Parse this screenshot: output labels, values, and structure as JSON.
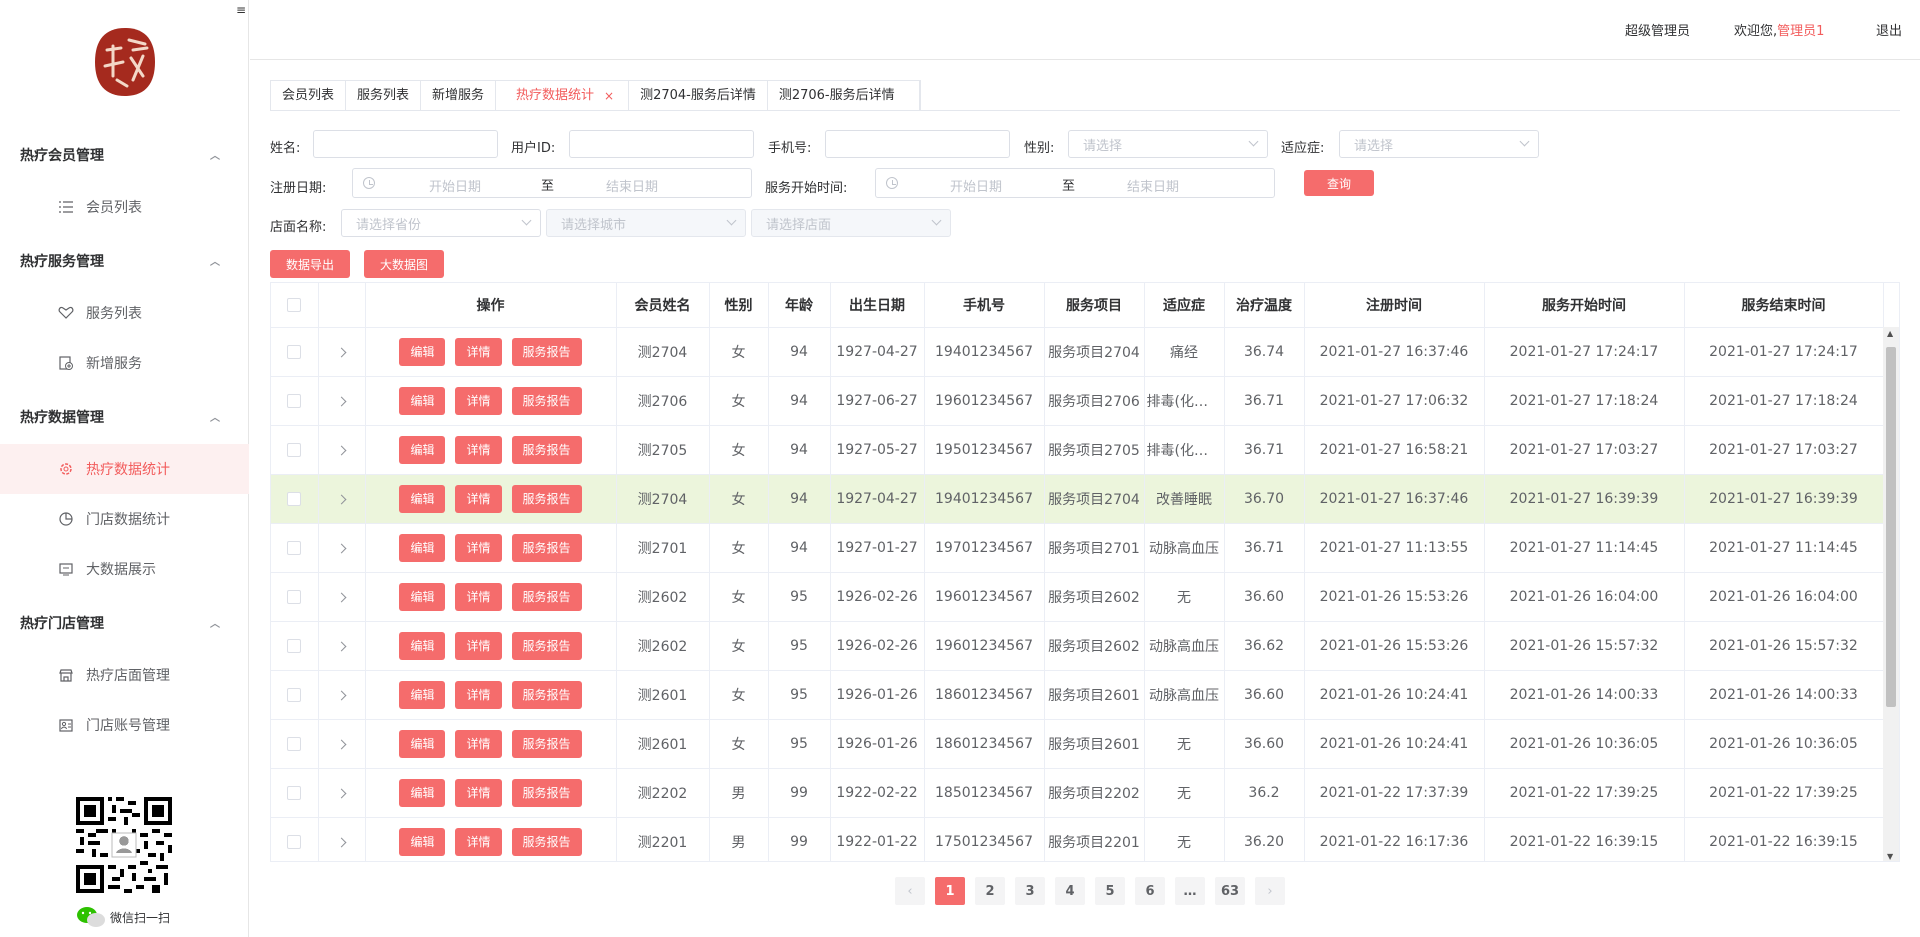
{
  "sidebar": {
    "collapse_icon": "≡",
    "groups": [
      {
        "title": "热疗会员管理",
        "items": [
          {
            "label": "会员列表",
            "icon": "list-icon"
          }
        ]
      },
      {
        "title": "热疗服务管理",
        "items": [
          {
            "label": "服务列表",
            "icon": "heart-hand-icon"
          },
          {
            "label": "新增服务",
            "icon": "add-doc-icon"
          }
        ]
      },
      {
        "title": "热疗数据管理",
        "items": [
          {
            "label": "热疗数据统计",
            "icon": "gear-icon",
            "active": true
          },
          {
            "label": "门店数据统计",
            "icon": "pie-icon"
          },
          {
            "label": "大数据展示",
            "icon": "screen-icon"
          }
        ]
      },
      {
        "title": "热疗门店管理",
        "items": [
          {
            "label": "热疗店面管理",
            "icon": "store-icon"
          },
          {
            "label": "门店账号管理",
            "icon": "account-icon"
          }
        ]
      }
    ],
    "wechat_label": "微信扫一扫"
  },
  "header": {
    "role": "超级管理员",
    "welcome_prefix": "欢迎您,",
    "username": "管理员1",
    "logout": "退出"
  },
  "tabs": [
    {
      "label": "会员列表"
    },
    {
      "label": "服务列表"
    },
    {
      "label": "新增服务"
    },
    {
      "label": "热疗数据统计",
      "active": true,
      "close": "×"
    },
    {
      "label": "测2704-服务后详情"
    },
    {
      "label": "测2706-服务后详情"
    }
  ],
  "filters": {
    "name_label": "姓名:",
    "userid_label": "用户ID:",
    "phone_label": "手机号:",
    "gender_label": "性别:",
    "gender_placeholder": "请选择",
    "indication_label": "适应症:",
    "indication_placeholder": "请选择",
    "register_date_label": "注册日期:",
    "service_start_label": "服务开始时间:",
    "start_date": "开始日期",
    "range_sep": "至",
    "end_date": "结束日期",
    "query_button": "查询",
    "store_label": "店面名称:",
    "province_placeholder": "请选择省份",
    "city_placeholder": "请选择城市",
    "store_placeholder": "请选择店面",
    "export_button": "数据导出",
    "bigdata_button": "大数据图"
  },
  "table": {
    "columns": [
      "",
      "",
      "操作",
      "会员姓名",
      "性别",
      "年龄",
      "出生日期",
      "手机号",
      "服务项目",
      "适应症",
      "治疗温度",
      "注册时间",
      "服务开始时间",
      "服务结束时间"
    ],
    "op_buttons": [
      "编辑",
      "详情",
      "服务报告"
    ],
    "rows": [
      {
        "name": "测2704",
        "gender": "女",
        "age": "94",
        "birth": "1927-04-27",
        "phone": "19401234567",
        "service": "服务项目2704",
        "indication": "痛经",
        "temp": "36.74",
        "reg": "2021-01-27 16:37:46",
        "start": "2021-01-27 17:24:17",
        "end": "2021-01-27 17:24:17"
      },
      {
        "name": "测2706",
        "gender": "女",
        "age": "94",
        "birth": "1927-06-27",
        "phone": "19601234567",
        "service": "服务项目2706",
        "indication": "排毒(化学药物)",
        "temp": "36.71",
        "reg": "2021-01-27 17:06:32",
        "start": "2021-01-27 17:18:24",
        "end": "2021-01-27 17:18:24"
      },
      {
        "name": "测2705",
        "gender": "女",
        "age": "94",
        "birth": "1927-05-27",
        "phone": "19501234567",
        "service": "服务项目2705",
        "indication": "排毒(化学药物)",
        "temp": "36.71",
        "reg": "2021-01-27 16:58:21",
        "start": "2021-01-27 17:03:27",
        "end": "2021-01-27 17:03:27"
      },
      {
        "name": "测2704",
        "gender": "女",
        "age": "94",
        "birth": "1927-04-27",
        "phone": "19401234567",
        "service": "服务项目2704",
        "indication": "改善睡眠",
        "temp": "36.70",
        "reg": "2021-01-27 16:37:46",
        "start": "2021-01-27 16:39:39",
        "end": "2021-01-27 16:39:39",
        "highlight": true
      },
      {
        "name": "测2701",
        "gender": "女",
        "age": "94",
        "birth": "1927-01-27",
        "phone": "19701234567",
        "service": "服务项目2701",
        "indication": "动脉高血压",
        "temp": "36.71",
        "reg": "2021-01-27 11:13:55",
        "start": "2021-01-27 11:14:45",
        "end": "2021-01-27 11:14:45"
      },
      {
        "name": "测2602",
        "gender": "女",
        "age": "95",
        "birth": "1926-02-26",
        "phone": "19601234567",
        "service": "服务项目2602",
        "indication": "无",
        "temp": "36.60",
        "reg": "2021-01-26 15:53:26",
        "start": "2021-01-26 16:04:00",
        "end": "2021-01-26 16:04:00"
      },
      {
        "name": "测2602",
        "gender": "女",
        "age": "95",
        "birth": "1926-02-26",
        "phone": "19601234567",
        "service": "服务项目2602",
        "indication": "动脉高血压",
        "temp": "36.62",
        "reg": "2021-01-26 15:53:26",
        "start": "2021-01-26 15:57:32",
        "end": "2021-01-26 15:57:32"
      },
      {
        "name": "测2601",
        "gender": "女",
        "age": "95",
        "birth": "1926-01-26",
        "phone": "18601234567",
        "service": "服务项目2601",
        "indication": "动脉高血压",
        "temp": "36.60",
        "reg": "2021-01-26 10:24:41",
        "start": "2021-01-26 14:00:33",
        "end": "2021-01-26 14:00:33"
      },
      {
        "name": "测2601",
        "gender": "女",
        "age": "95",
        "birth": "1926-01-26",
        "phone": "18601234567",
        "service": "服务项目2601",
        "indication": "无",
        "temp": "36.60",
        "reg": "2021-01-26 10:24:41",
        "start": "2021-01-26 10:36:05",
        "end": "2021-01-26 10:36:05"
      },
      {
        "name": "测2202",
        "gender": "男",
        "age": "99",
        "birth": "1922-02-22",
        "phone": "18501234567",
        "service": "服务项目2202",
        "indication": "无",
        "temp": "36.2",
        "reg": "2021-01-22 17:37:39",
        "start": "2021-01-22 17:39:25",
        "end": "2021-01-22 17:39:25"
      },
      {
        "name": "测2201",
        "gender": "男",
        "age": "99",
        "birth": "1922-01-22",
        "phone": "17501234567",
        "service": "服务项目2201",
        "indication": "无",
        "temp": "36.20",
        "reg": "2021-01-22 16:17:36",
        "start": "2021-01-22 16:39:15",
        "end": "2021-01-22 16:39:15"
      }
    ]
  },
  "pagination": {
    "prev": "‹",
    "pages": [
      "1",
      "2",
      "3",
      "4",
      "5",
      "6",
      "…",
      "63"
    ],
    "current": "1",
    "next": "›"
  },
  "colors": {
    "accent": "#f56c6c",
    "highlight_row": "#ecf5dc",
    "active_menu_bg": "#fdf0f0"
  }
}
